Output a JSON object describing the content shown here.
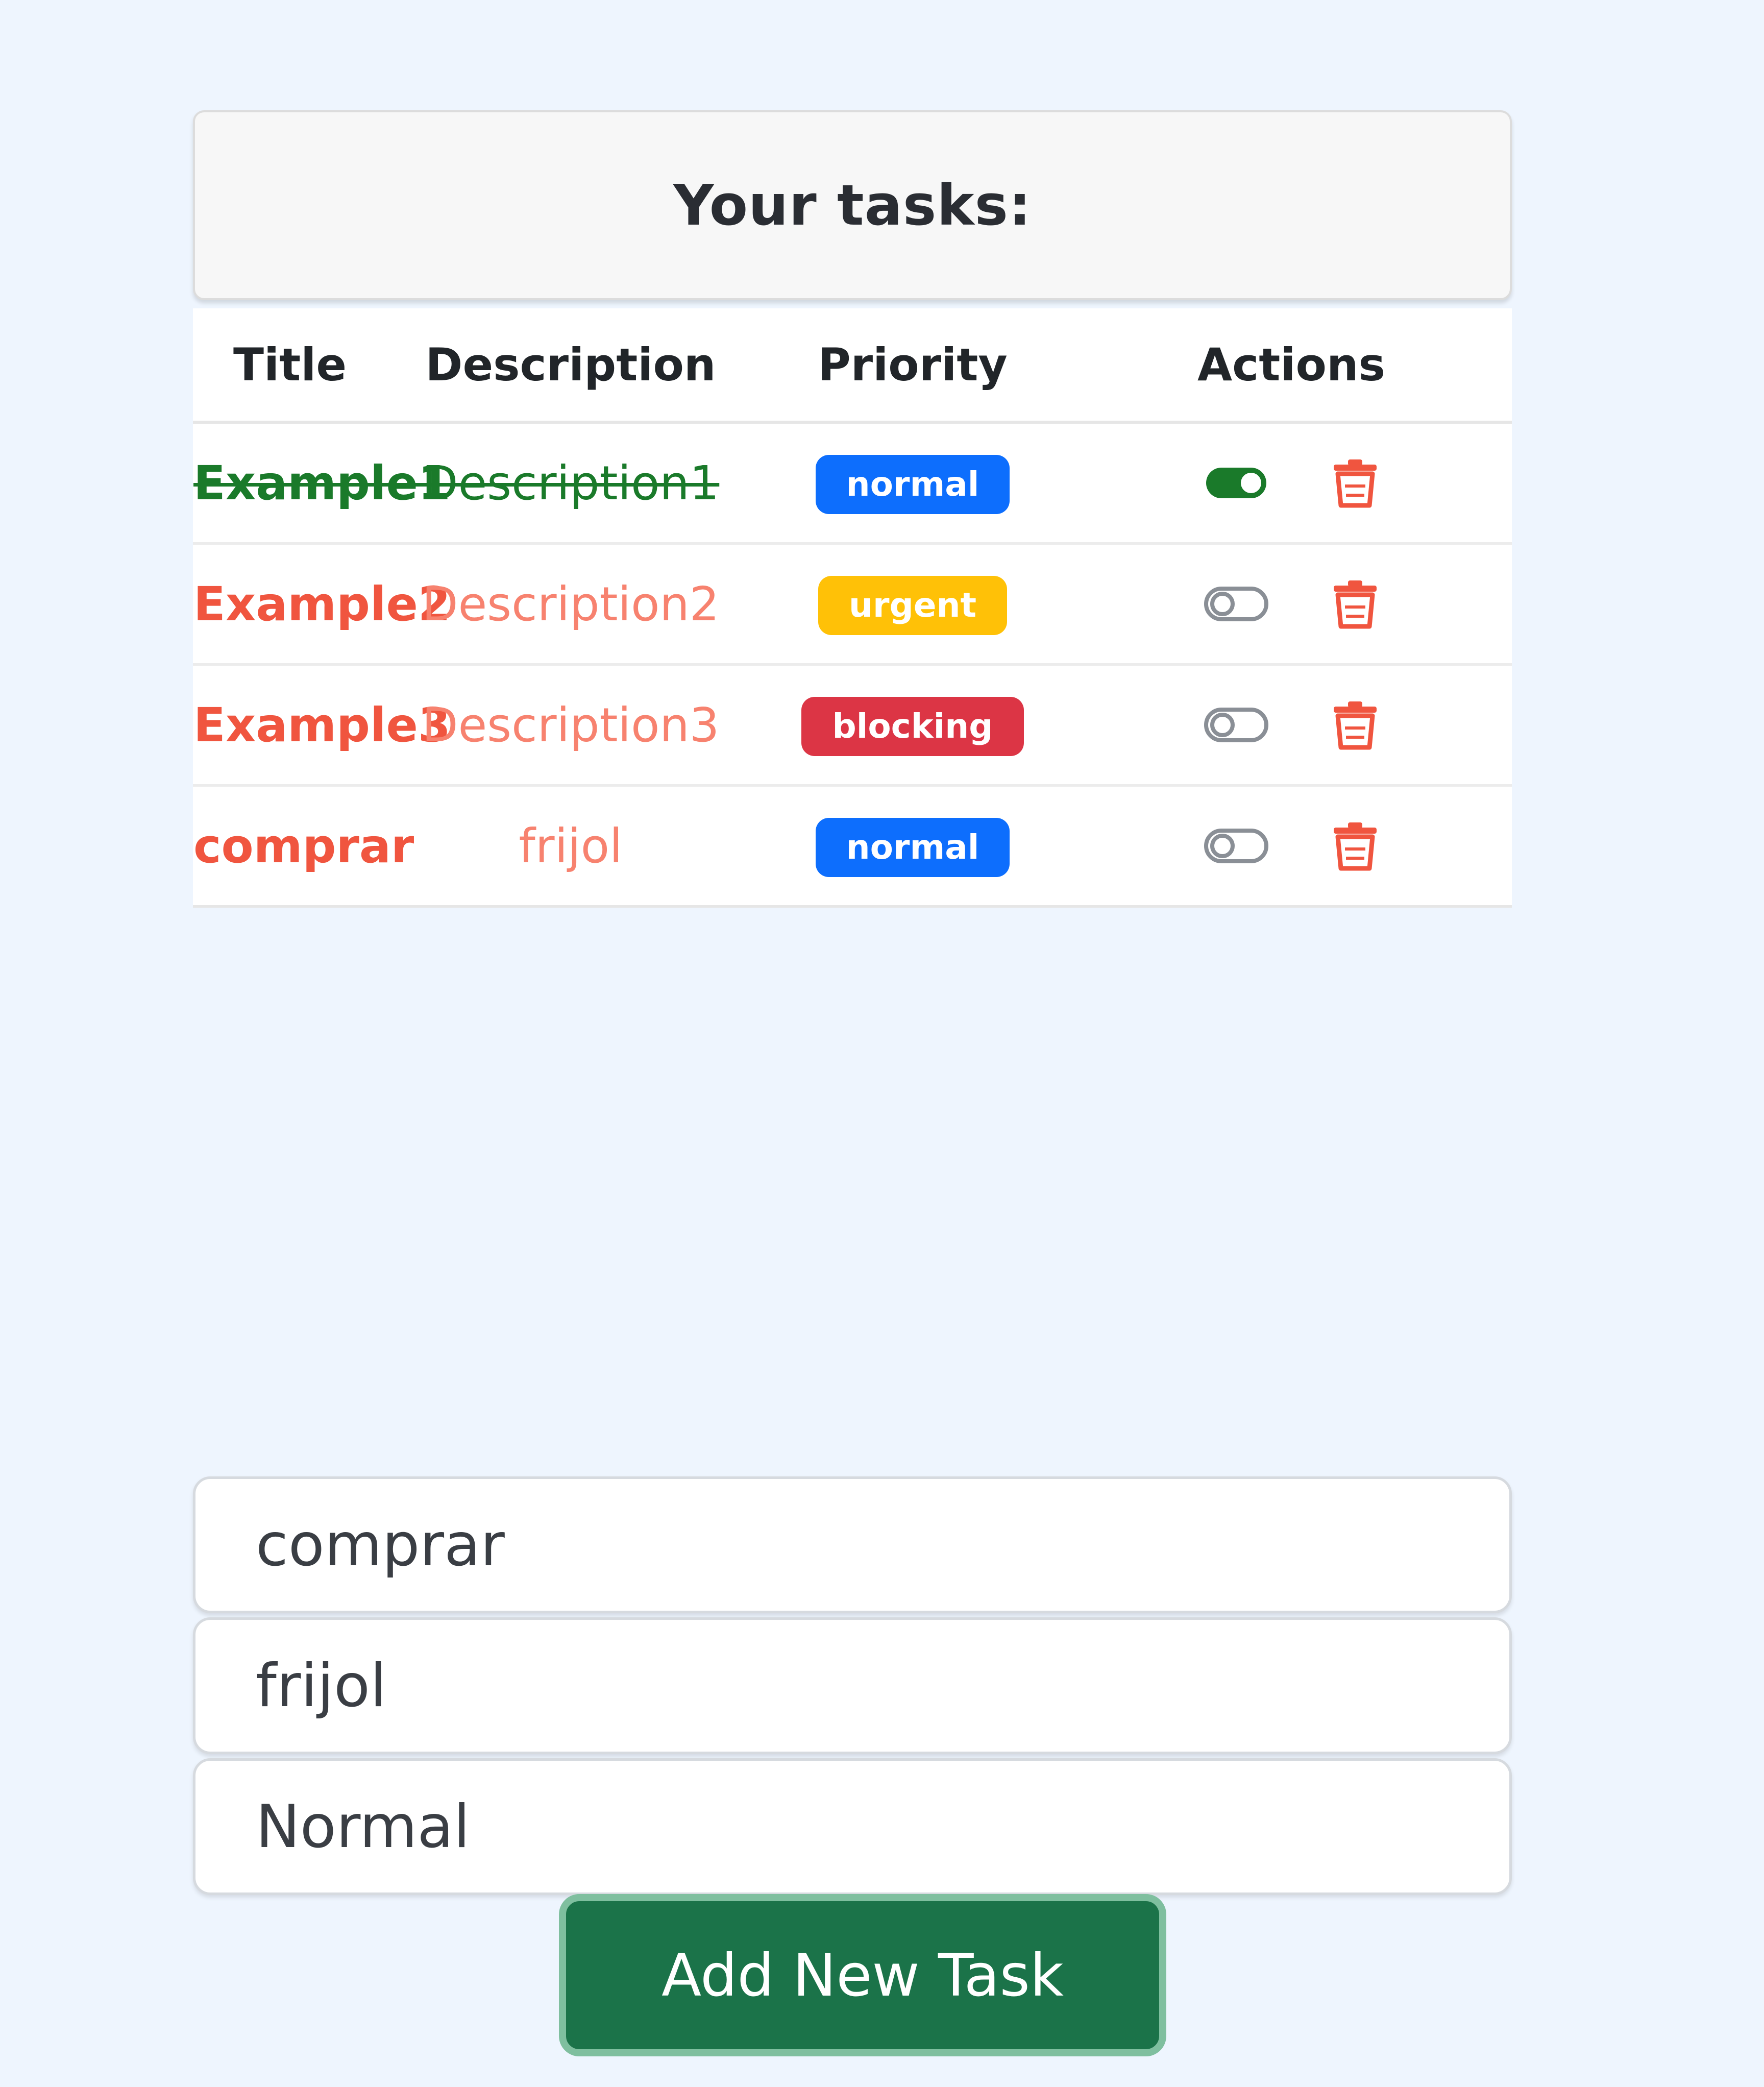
{
  "tasks_card": {
    "title": "Your tasks:"
  },
  "table": {
    "headers": {
      "title": "Title",
      "description": "Description",
      "priority": "Priority",
      "actions": "Actions"
    },
    "rows": [
      {
        "title": "Example1",
        "description": "Description1",
        "priority": "normal",
        "priority_color": "#0d6efd",
        "completed": true
      },
      {
        "title": "Example2",
        "description": "Description2",
        "priority": "urgent",
        "priority_color": "#ffc107",
        "completed": false
      },
      {
        "title": "Example3",
        "description": "Description3",
        "priority": "blocking",
        "priority_color": "#dc3545",
        "completed": false
      },
      {
        "title": "comprar",
        "description": "frijol",
        "priority": "normal",
        "priority_color": "#0d6efd",
        "completed": false
      }
    ],
    "toggle_icon": "toggle-icon",
    "delete_icon": "trash-icon",
    "done_color": "#1a7a2a",
    "pending_color": "#f0553f",
    "delete_color": "#f0553f"
  },
  "form": {
    "title_value": "comprar",
    "description_value": "frijol",
    "priority_value": "Normal",
    "submit_label": "Add New Task",
    "submit_color": "#1b7349"
  }
}
